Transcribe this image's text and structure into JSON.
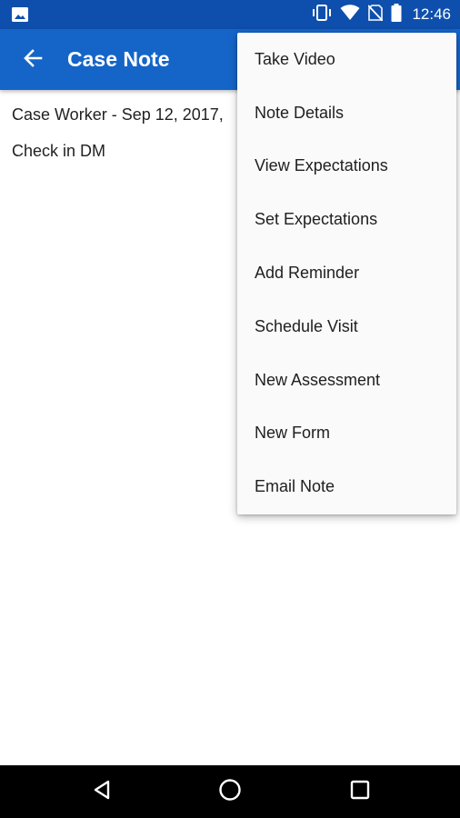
{
  "status_bar": {
    "time": "12:46",
    "icons": [
      "gallery-icon",
      "vibrate-icon",
      "wifi-icon",
      "no-sim-icon",
      "battery-icon"
    ]
  },
  "app_bar": {
    "title": "Case Note",
    "back_icon": "arrow-back-icon"
  },
  "content": {
    "meta_line": "Case Worker - Sep 12, 2017,",
    "note_text": "Check in DM"
  },
  "menu": {
    "items": [
      {
        "label": "Take Video"
      },
      {
        "label": "Note Details"
      },
      {
        "label": "View Expectations"
      },
      {
        "label": "Set Expectations"
      },
      {
        "label": "Add Reminder"
      },
      {
        "label": "Schedule Visit"
      },
      {
        "label": "New Assessment"
      },
      {
        "label": "New Form"
      },
      {
        "label": "Email Note"
      }
    ]
  },
  "nav_bar": {
    "buttons": [
      "back-triangle-icon",
      "home-circle-icon",
      "recents-square-icon"
    ]
  },
  "colors": {
    "status_bar": "#0e4fad",
    "app_bar": "#1565c8",
    "menu_bg": "#fafafa",
    "nav_bar": "#000000"
  }
}
